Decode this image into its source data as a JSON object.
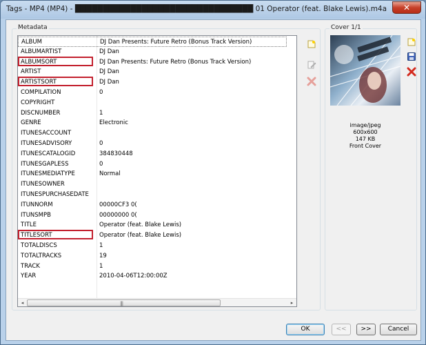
{
  "window": {
    "title": "Tags - MP4 (MP4) - ████████████████████████████████ 01 Operator (feat. Blake Lewis).m4a",
    "close_label": "✕"
  },
  "metadata": {
    "group_label": "Metadata",
    "tags": [
      {
        "key": "ALBUM",
        "value": "DJ Dan Presents: Future Retro (Bonus Track Version)",
        "highlighted": false
      },
      {
        "key": "ALBUMARTIST",
        "value": "DJ Dan",
        "highlighted": false
      },
      {
        "key": "ALBUMSORT",
        "value": "DJ Dan Presents: Future Retro (Bonus Track Version)",
        "highlighted": true
      },
      {
        "key": "ARTIST",
        "value": "DJ Dan",
        "highlighted": false
      },
      {
        "key": "ARTISTSORT",
        "value": "DJ Dan",
        "highlighted": true
      },
      {
        "key": "COMPILATION",
        "value": "0",
        "highlighted": false
      },
      {
        "key": "COPYRIGHT",
        "value": "",
        "highlighted": false
      },
      {
        "key": "DISCNUMBER",
        "value": "1",
        "highlighted": false
      },
      {
        "key": "GENRE",
        "value": "Electronic",
        "highlighted": false
      },
      {
        "key": "ITUNESACCOUNT",
        "value": "",
        "highlighted": false
      },
      {
        "key": "ITUNESADVISORY",
        "value": "0",
        "highlighted": false
      },
      {
        "key": "ITUNESCATALOGID",
        "value": "384830448",
        "highlighted": false
      },
      {
        "key": "ITUNESGAPLESS",
        "value": "0",
        "highlighted": false
      },
      {
        "key": "ITUNESMEDIATYPE",
        "value": "Normal",
        "highlighted": false
      },
      {
        "key": "ITUNESOWNER",
        "value": "",
        "highlighted": false
      },
      {
        "key": "ITUNESPURCHASEDATE",
        "value": "",
        "highlighted": false
      },
      {
        "key": "ITUNNORM",
        "value": " 00000CF3 0(",
        "highlighted": false
      },
      {
        "key": "ITUNSMPB",
        "value": " 00000000 0(",
        "highlighted": false
      },
      {
        "key": "TITLE",
        "value": "Operator (feat. Blake Lewis)",
        "highlighted": false
      },
      {
        "key": "TITLESORT",
        "value": "Operator (feat. Blake Lewis)",
        "highlighted": true
      },
      {
        "key": "TOTALDISCS",
        "value": "1",
        "highlighted": false
      },
      {
        "key": "TOTALTRACKS",
        "value": "19",
        "highlighted": false
      },
      {
        "key": "TRACK",
        "value": "1",
        "highlighted": false
      },
      {
        "key": "YEAR",
        "value": "2010-04-06T12:00:00Z",
        "highlighted": false
      }
    ],
    "scroll_left": "◂",
    "scroll_right": "▸",
    "scroll_grip": "|||"
  },
  "cover": {
    "group_label": "Cover 1/1",
    "mime": "image/jpeg",
    "dimensions": "600x600",
    "size": "147 KB",
    "type": "Front Cover"
  },
  "buttons": {
    "ok": "OK",
    "prev": "<<",
    "next": ">>",
    "cancel": "Cancel"
  },
  "icons": {
    "add": "add-tag-icon",
    "edit": "edit-tag-icon",
    "remove": "remove-tag-icon",
    "add_cover": "add-cover-icon",
    "save_cover": "save-cover-icon",
    "remove_cover": "remove-cover-icon"
  },
  "colors": {
    "highlight_box": "#c21e2c",
    "window_frame": "#b9d1ea"
  }
}
